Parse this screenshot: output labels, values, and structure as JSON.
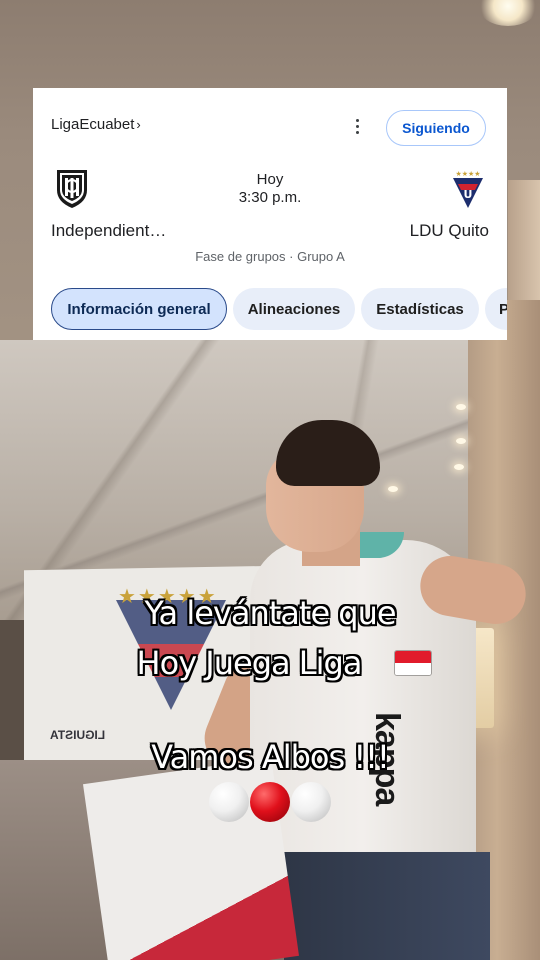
{
  "match_card": {
    "league": "LigaEcuabet",
    "league_chevron": "›",
    "more_icon": "more-vert-icon",
    "follow_label": "Siguiendo",
    "day": "Hoy",
    "time": "3:30 p.m.",
    "home_team": {
      "name": "Independient…",
      "logo": "independiente-del-valle-crest"
    },
    "away_team": {
      "name": "LDU Quito",
      "logo": "ldu-quito-crest"
    },
    "stage": "Fase de grupos · Grupo A",
    "tabs": [
      {
        "label": "Información general",
        "active": true
      },
      {
        "label": "Alineaciones",
        "active": false
      },
      {
        "label": "Estadísticas",
        "active": false
      },
      {
        "label": "P",
        "active": false
      }
    ]
  },
  "caption": {
    "line1": "Ya levántate que",
    "line2": "Hoy Juega Liga",
    "line3": "Vamos Albos !!!",
    "emoji_flag": "flag-emoji",
    "emoji_balls": [
      "white-circle",
      "red-circle",
      "white-circle"
    ]
  },
  "photo": {
    "jersey_brand": "kappa",
    "banner_text": "LIGUISTA"
  },
  "colors": {
    "follow_text": "#0b57d0",
    "active_tab_border": "#2a4a8a",
    "caption_text": "#ffffff"
  }
}
